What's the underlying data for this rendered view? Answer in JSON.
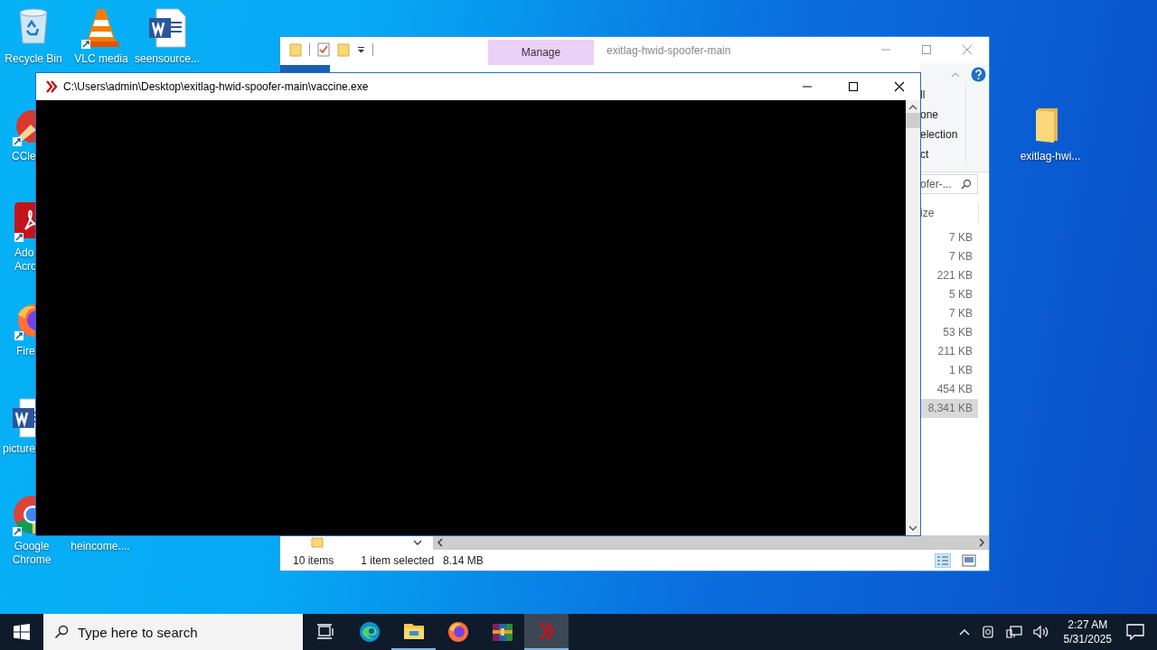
{
  "desktop_icons": [
    {
      "kind": "recycle-bin",
      "label": [
        "Recycle Bin"
      ]
    },
    {
      "kind": "cone",
      "label": [
        "VLC media"
      ]
    },
    {
      "kind": "word",
      "label": [
        "seensource..."
      ]
    },
    {
      "kind": "brush",
      "label": [
        "CCle"
      ]
    },
    {
      "kind": "acrobat",
      "label": [
        "Ado",
        "Acro"
      ]
    },
    {
      "kind": "firefox",
      "label": [
        "Fire"
      ]
    },
    {
      "kind": "word",
      "label": [
        "picture"
      ]
    },
    {
      "kind": "chrome",
      "label": [
        "Google",
        "Chrome"
      ]
    },
    {
      "kind": "none",
      "label": [
        "heincome...."
      ]
    },
    {
      "kind": "folder",
      "label": [
        "exitlag-hwi..."
      ]
    }
  ],
  "explorer": {
    "title": "exitlag-hwid-spoofer-main",
    "context_tab": "Manage",
    "ribbon_items": [
      "ll",
      "one",
      "election",
      "ct"
    ],
    "search": {
      "value": "ofer-..."
    },
    "size_column": "ize",
    "sizes": [
      {
        "text": "7 KB",
        "selected": false
      },
      {
        "text": "7 KB",
        "selected": false
      },
      {
        "text": "221 KB",
        "selected": false
      },
      {
        "text": "5 KB",
        "selected": false
      },
      {
        "text": "7 KB",
        "selected": false
      },
      {
        "text": "53 KB",
        "selected": false
      },
      {
        "text": "211 KB",
        "selected": false
      },
      {
        "text": "1 KB",
        "selected": false
      },
      {
        "text": "454 KB",
        "selected": false
      },
      {
        "text": "8,341 KB",
        "selected": true
      }
    ],
    "status": {
      "count": "10 items",
      "selection": "1 item selected",
      "size": "8.14 MB"
    }
  },
  "console": {
    "title": "C:\\Users\\admin\\Desktop\\exitlag-hwid-spoofer-main\\vaccine.exe"
  },
  "taskbar": {
    "search_placeholder": "Type here to search",
    "apps": [
      {
        "kind": "task-view",
        "running": false,
        "active": false
      },
      {
        "kind": "edge",
        "running": false,
        "active": false
      },
      {
        "kind": "explorer",
        "running": true,
        "active": false
      },
      {
        "kind": "firefox",
        "running": false,
        "active": false
      },
      {
        "kind": "archive",
        "running": false,
        "active": false
      },
      {
        "kind": "vaccine",
        "running": true,
        "active": true
      }
    ],
    "time": "2:27 AM",
    "date": "5/31/2025"
  }
}
